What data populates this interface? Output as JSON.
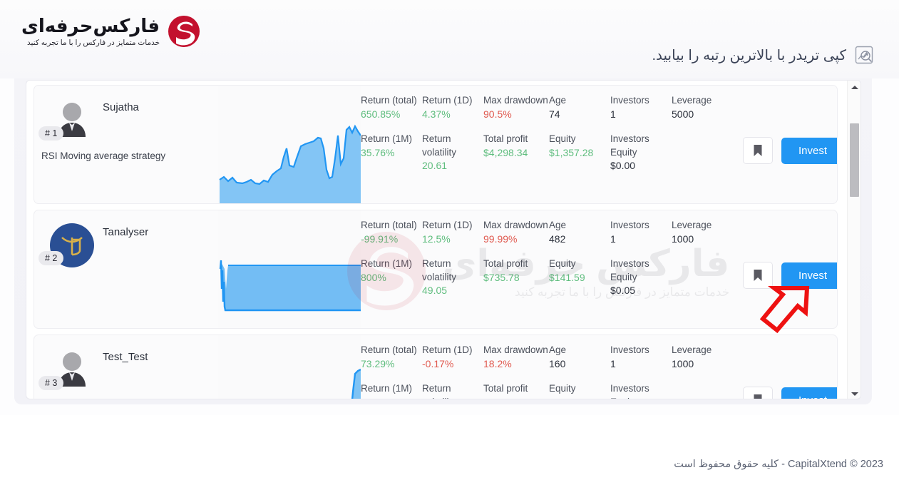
{
  "brand": {
    "logo_main": "فارکس‌حرفه‌ای",
    "logo_sub": "خدمات متمایز در فارکس را با ما تجربه کنید",
    "logo_mark_color": "#c3112e",
    "logo_icon": "swoosh-s-logo"
  },
  "header": {
    "title": "کپی تریدر با بالاترین رتبه را بیابید.",
    "icon": "chart-search-icon",
    "icon_color": "#8a90a0"
  },
  "colors": {
    "positive": "#5fbd7e",
    "negative": "#e05a50",
    "accent": "#2196f3",
    "annotation_arrow": "#ee1111"
  },
  "labels": {
    "return_total": "Return (total)",
    "return_1d": "Return (1D)",
    "max_drawdown": "Max drawdown",
    "age": "Age",
    "investors": "Investors",
    "leverage": "Leverage",
    "return_1m": "Return (1M)",
    "return_volatility": "Return volatility",
    "total_profit": "Total profit",
    "equity": "Equity",
    "investors_equity": "Investors Equity",
    "invest": "Invest",
    "bookmark_icon": "bookmark-icon"
  },
  "traders": [
    {
      "rank": "# 1",
      "name": "Sujatha",
      "strategy": "RSI Moving average strategy",
      "avatar": "generic-user-avatar",
      "return_total": "650.85%",
      "return_total_sign": "pos",
      "return_1d": "4.37%",
      "return_1d_sign": "pos",
      "max_drawdown": "90.5%",
      "max_drawdown_sign": "neg",
      "age": "74",
      "investors": "1",
      "leverage": "5000",
      "return_1m": "35.76%",
      "return_1m_sign": "pos",
      "return_volatility": "20.61",
      "return_volatility_sign": "pos",
      "total_profit": "$4,298.34",
      "total_profit_sign": "pos",
      "equity": "$1,357.28",
      "equity_sign": "pos",
      "investors_equity": "$0.00",
      "chart": "rising-area-chart"
    },
    {
      "rank": "# 2",
      "name": "Tanalyser",
      "strategy": "",
      "avatar": "tanalyser-logo-avatar",
      "return_total": "-99.91%",
      "return_total_sign": "pos",
      "return_1d": "12.5%",
      "return_1d_sign": "pos",
      "max_drawdown": "99.99%",
      "max_drawdown_sign": "neg",
      "age": "482",
      "investors": "1",
      "leverage": "1000",
      "return_1m": "800%",
      "return_1m_sign": "pos",
      "return_volatility": "49.05",
      "return_volatility_sign": "pos",
      "total_profit": "$735.78",
      "total_profit_sign": "pos",
      "equity": "$141.59",
      "equity_sign": "pos",
      "investors_equity": "$0.05",
      "chart": "flat-block-area-chart"
    },
    {
      "rank": "# 3",
      "name": "Test_Test",
      "strategy": "",
      "avatar": "generic-user-avatar",
      "return_total": "73.29%",
      "return_total_sign": "pos",
      "return_1d": "-0.17%",
      "return_1d_sign": "neg",
      "max_drawdown": "18.2%",
      "max_drawdown_sign": "neg",
      "age": "160",
      "investors": "1",
      "leverage": "1000",
      "return_1m": "",
      "return_1m_sign": "pos",
      "return_volatility": "",
      "return_volatility_sign": "pos",
      "total_profit": "",
      "total_profit_sign": "pos",
      "equity": "",
      "equity_sign": "pos",
      "investors_equity": "",
      "chart": "end-spike-area-chart"
    }
  ],
  "watermark": {
    "main": "فارکس حرفه‌ای",
    "sub": "خدمات متمایز در فارکس را با ما تجربه کنید"
  },
  "footer": {
    "text": "2023 © CapitalXtend - کلیه حقوق محفوظ است"
  }
}
